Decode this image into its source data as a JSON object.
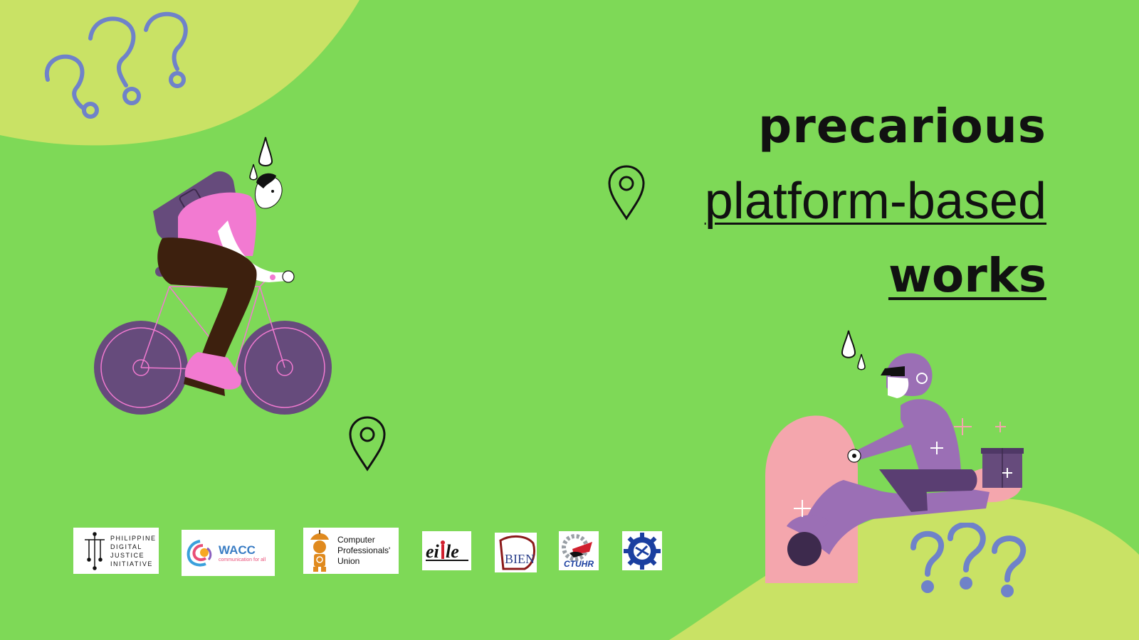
{
  "colors": {
    "background": "#7ed957",
    "blob": "#c9e265",
    "question_marks": "#6f82c9",
    "ink": "#111111",
    "purple": "#664b7c",
    "pink": "#f27ad1",
    "scooter_pink": "#f4a6ad",
    "lavender": "#9b6fb5"
  },
  "headline": {
    "line1": "precarious",
    "line2": "platform-based",
    "line3": "works"
  },
  "illustrations": {
    "question_marks_top": "question-marks-icon",
    "question_marks_bottom": "question-marks-icon",
    "cyclist": "bicycle-courier-illustration",
    "scooter_rider": "scooter-delivery-rider-illustration",
    "pin": "map-pin-icon"
  },
  "logos": {
    "pdji": {
      "line1": "PHILIPPINE",
      "line2": "DIGITAL",
      "line3": "JUSTICE",
      "line4": "INITIATIVE"
    },
    "wacc": {
      "name": "WACC",
      "tagline": "communication for all"
    },
    "cpu": {
      "line1": "Computer",
      "line2": "Professionals'",
      "line3": "Union"
    },
    "eiler": {
      "name": "eiler"
    },
    "bien": {
      "name": "BIEN"
    },
    "ctuhr": {
      "name": "CTUHR"
    },
    "gear": {
      "name": "gear-logo-icon"
    }
  }
}
